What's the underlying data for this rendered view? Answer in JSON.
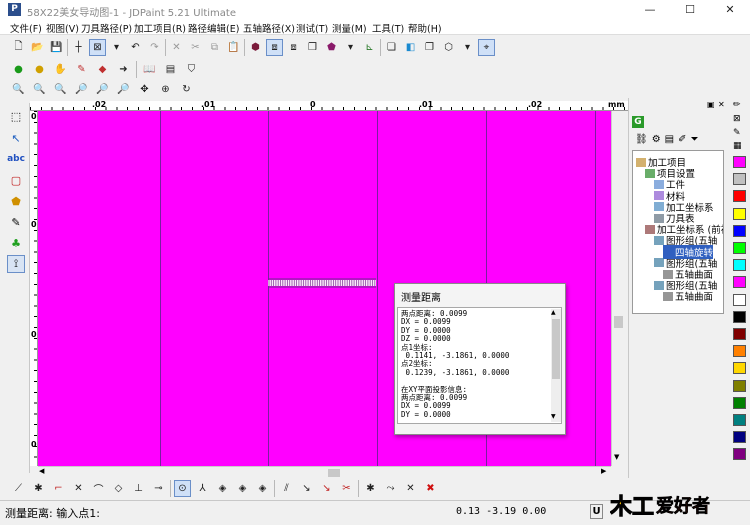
{
  "window": {
    "title": "58X22美女导动图-1 - JDPaint 5.21 Ultimate",
    "app_icon": "P",
    "controls": [
      "—",
      "☐",
      "✕"
    ]
  },
  "menu": [
    "文件(F)",
    "视图(V)",
    "刀具路径(P)",
    "加工项目(R)",
    "路径编辑(E)",
    "五轴路径(X)",
    "测试(T)",
    "测量(M)",
    "工具(T)",
    "帮助(H)"
  ],
  "ruler": {
    "top_labels": [
      ".02",
      ".01",
      "0",
      ".01",
      ".02"
    ],
    "unit": "mm",
    "left_labels": [
      "0",
      "0",
      "0",
      "0"
    ]
  },
  "right_panel": {
    "tab_icon": "G",
    "tree": [
      {
        "label": "加工项目",
        "indent": 0
      },
      {
        "label": "项目设置",
        "indent": 1
      },
      {
        "label": "工件",
        "indent": 2
      },
      {
        "label": "材料",
        "indent": 2
      },
      {
        "label": "加工坐标系",
        "indent": 2
      },
      {
        "label": "刀具表",
        "indent": 2
      },
      {
        "label": "加工坐标系 (前视",
        "indent": 1
      },
      {
        "label": "图形组(五轴",
        "indent": 2
      },
      {
        "label": "四轴旋转",
        "indent": 3
      },
      {
        "label": "图形组(五轴",
        "indent": 2
      },
      {
        "label": "五轴曲面",
        "indent": 3
      },
      {
        "label": "图形组(五轴",
        "indent": 2
      },
      {
        "label": "五轴曲面",
        "indent": 3
      }
    ]
  },
  "palette": [
    "#ff00ff",
    "#c0c0c0",
    "#ff0000",
    "#ffff00",
    "#0000ff",
    "#00ff00",
    "#00ffff",
    "#ff00ff",
    "#ffffff",
    "#000000",
    "#800000",
    "#ff8000",
    "#ffd700",
    "#808000",
    "#008000",
    "#008080",
    "#000080",
    "#800080"
  ],
  "dialog": {
    "title": "测量距离",
    "lines": [
      "两点距离: 0.0099",
      "DX = 0.0099",
      "DY = 0.0000",
      "DZ = 0.0000",
      "点1坐标:",
      " 0.1141, -3.1861, 0.0000",
      "点2坐标:",
      " 0.1239, -3.1861, 0.0000",
      "",
      "在XY平面投影信息:",
      "两点距离: 0.0099",
      "DX = 0.0099",
      "DY = 0.0000"
    ]
  },
  "status": {
    "prompt": "测量距离: 输入点1:",
    "coords": "0.13 -3.19 0.00",
    "u_button": "U"
  },
  "watermark_text": "木工爱好者"
}
